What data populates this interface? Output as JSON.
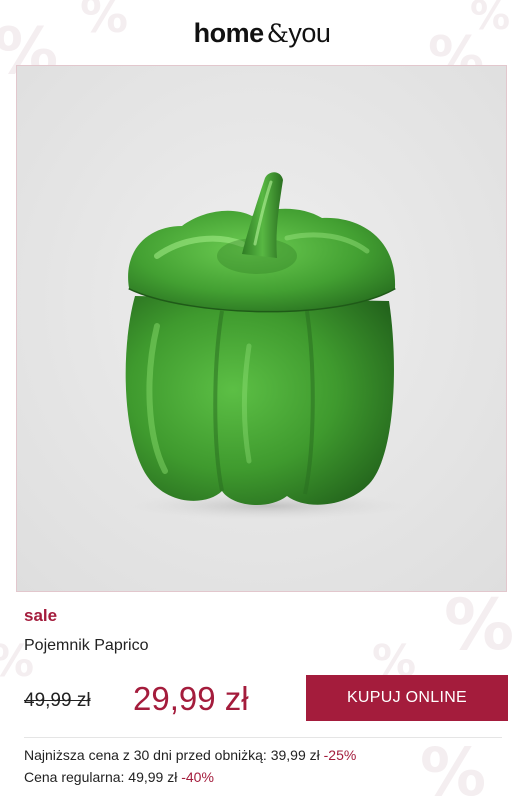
{
  "brand": {
    "logo_bold": "home",
    "logo_amp": "&",
    "logo_light": "you"
  },
  "product": {
    "image_subject": "green pepper-shaped ceramic container",
    "sale_label": "sale",
    "name": "Pojemnik Paprico",
    "old_price": "49,99 zł",
    "new_price": "29,99 zł",
    "buy_label": "KUPUJ ONLINE",
    "lowest_price_text": "Najniższa cena z 30 dni przed obniżką: 39,99 zł",
    "lowest_price_discount": "-25%",
    "regular_price_text": "Cena regularna: 49,99 zł",
    "regular_price_discount": "-40%"
  },
  "colors": {
    "accent": "#a41c3c",
    "photo_background": "#e7e7e7",
    "pepper_green": "#3f9a2e"
  },
  "decorations": {
    "background_marks": [
      "%",
      "%",
      "%",
      "%",
      "%",
      "%",
      "%",
      "%"
    ]
  }
}
